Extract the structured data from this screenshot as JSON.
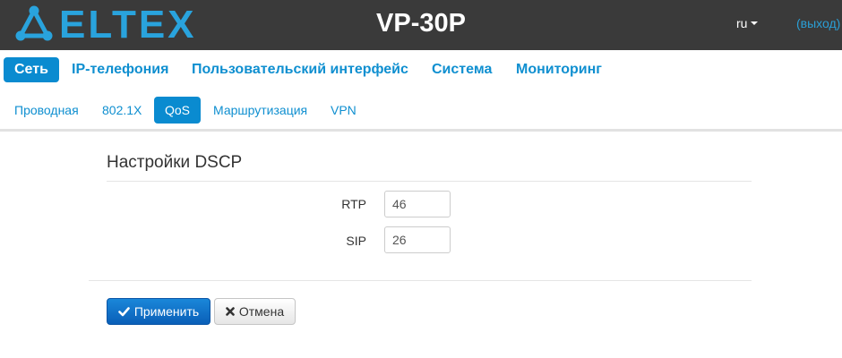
{
  "header": {
    "logo_text": "ELTEX",
    "device_title": "VP-30P",
    "language": "ru",
    "logout_label": "(выход)"
  },
  "main_nav": {
    "items": [
      {
        "label": "Сеть",
        "active": true
      },
      {
        "label": "IP-телефония",
        "active": false
      },
      {
        "label": "Пользовательский интерфейс",
        "active": false
      },
      {
        "label": "Система",
        "active": false
      },
      {
        "label": "Мониторинг",
        "active": false
      }
    ]
  },
  "sub_nav": {
    "items": [
      {
        "label": "Проводная",
        "active": false
      },
      {
        "label": "802.1X",
        "active": false
      },
      {
        "label": "QoS",
        "active": true
      },
      {
        "label": "Маршрутизация",
        "active": false
      },
      {
        "label": "VPN",
        "active": false
      }
    ]
  },
  "form": {
    "title": "Настройки DSCP",
    "fields": [
      {
        "label": "RTP",
        "value": "46"
      },
      {
        "label": "SIP",
        "value": "26"
      }
    ],
    "apply_label": "Применить",
    "cancel_label": "Отмена"
  },
  "colors": {
    "header_bg": "#3a3a3a",
    "brand": "#29a3dd",
    "link": "#0f8fd0",
    "active_tab": "#0a8bd0",
    "primary_button": "#0a6fc6"
  },
  "icons": {
    "logo": "eltex-logo-icon",
    "apply": "check-icon",
    "cancel": "times-icon",
    "language_dropdown": "caret-down-icon"
  }
}
